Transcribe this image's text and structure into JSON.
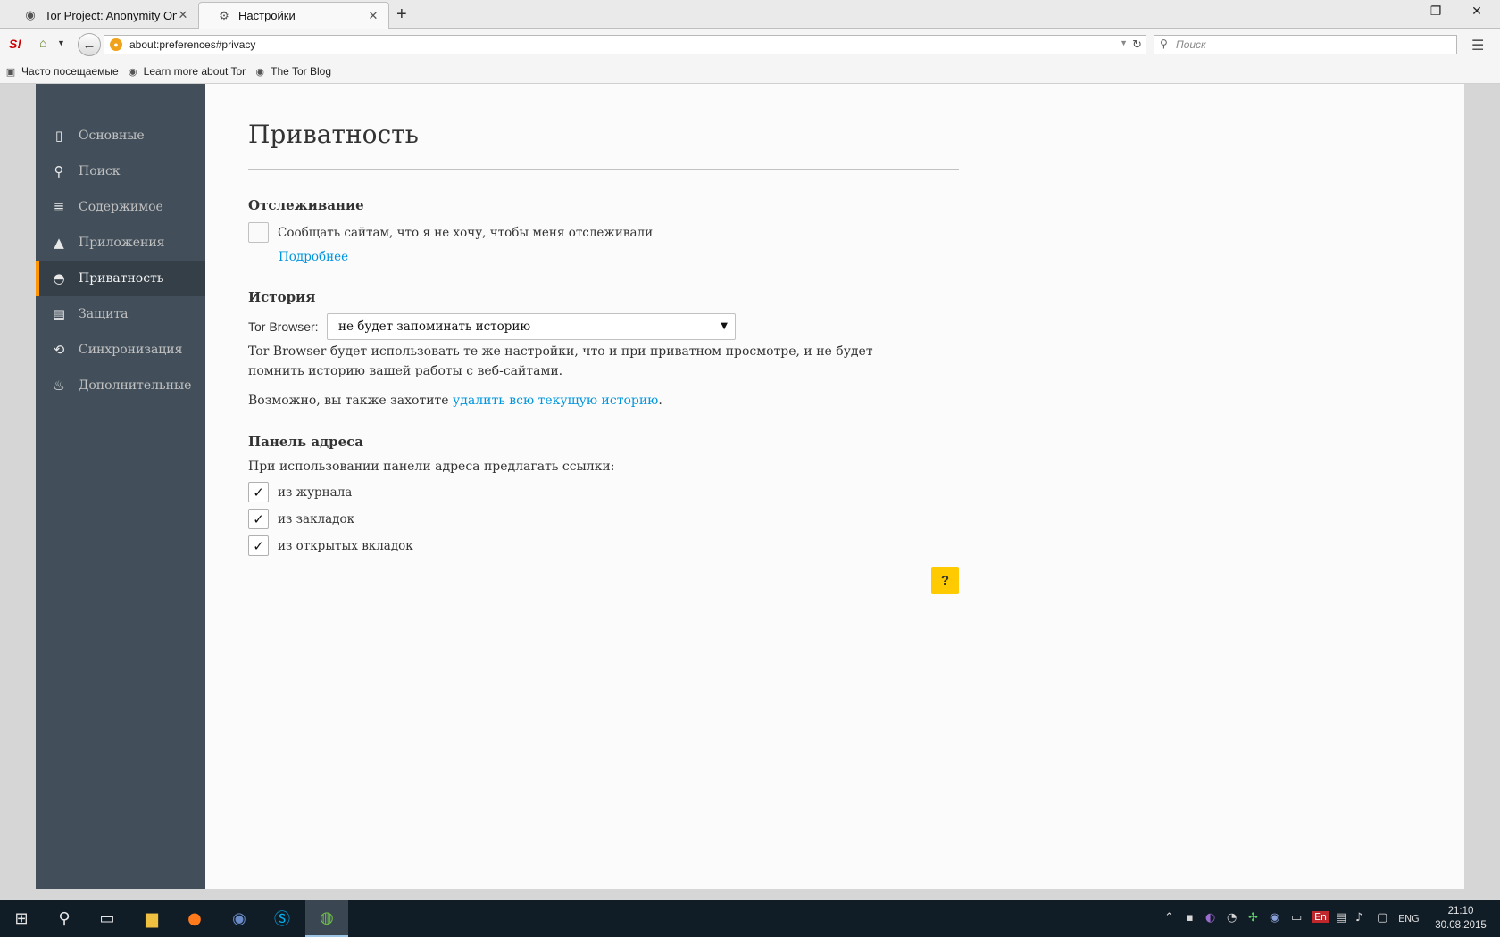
{
  "tabs": [
    {
      "title": "Tor Project: Anonymity On...",
      "icon": "onion-icon"
    },
    {
      "title": "Настройки",
      "icon": "gear-icon"
    }
  ],
  "navbar": {
    "url": "about:preferences#privacy",
    "search_placeholder": "Поиск"
  },
  "bookmarks": [
    {
      "label": "Часто посещаемые",
      "icon": "folder-icon"
    },
    {
      "label": "Learn more about Tor",
      "icon": "onion-icon"
    },
    {
      "label": "The Tor Blog",
      "icon": "onion-icon"
    }
  ],
  "sidebar": {
    "items": [
      {
        "label": "Основные",
        "icon": "general-icon"
      },
      {
        "label": "Поиск",
        "icon": "search-icon"
      },
      {
        "label": "Содержимое",
        "icon": "content-icon"
      },
      {
        "label": "Приложения",
        "icon": "applications-icon"
      },
      {
        "label": "Приватность",
        "icon": "privacy-mask-icon",
        "active": true
      },
      {
        "label": "Защита",
        "icon": "lock-icon"
      },
      {
        "label": "Синхронизация",
        "icon": "sync-icon"
      },
      {
        "label": "Дополнительные",
        "icon": "advanced-icon"
      }
    ]
  },
  "main": {
    "title": "Приватность",
    "tracking": {
      "heading": "Отслеживание",
      "dnt_label": "Сообщать сайтам, что я не хочу, чтобы меня отслеживали",
      "dnt_checked": false,
      "learn_more": "Подробнее"
    },
    "history": {
      "heading": "История",
      "label": "Tor Browser:",
      "selected": "не будет запоминать историю",
      "description": "Tor Browser будет использовать те же настройки, что и при приватном просмотре, и не будет помнить историю вашей работы с веб-сайтами.",
      "clear_prefix": "Возможно, вы также захотите ",
      "clear_link": "удалить всю текущую историю",
      "clear_suffix": "."
    },
    "locationbar": {
      "heading": "Панель адреса",
      "intro": "При использовании панели адреса предлагать ссылки:",
      "options": [
        {
          "label": "из журнала",
          "checked": true
        },
        {
          "label": "из закладок",
          "checked": true
        },
        {
          "label": "из открытых вкладок",
          "checked": true
        }
      ]
    },
    "help_label": "?"
  },
  "taskbar": {
    "language": "ENG",
    "time": "21:10",
    "date": "30.08.2015"
  }
}
